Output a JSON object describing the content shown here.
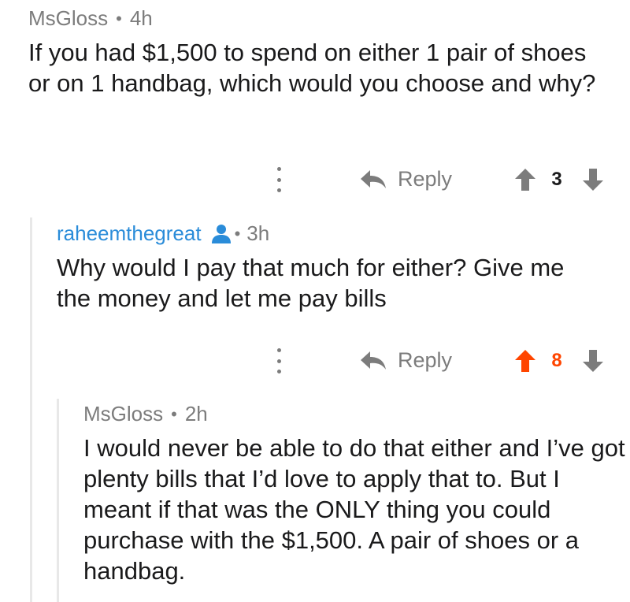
{
  "colors": {
    "meta_gray": "#7c7c7c",
    "username_blue": "#2a8cd9",
    "upvote_orange": "#ff4500",
    "icon_gray": "#7c7c7c",
    "thread_line": "#e8e8e8"
  },
  "comments": [
    {
      "author": "MsGloss",
      "separator": "•",
      "time": "4h",
      "body": "If you had $1,500 to spend on either 1 pair of shoes or on 1 handbag, which would you choose and why?",
      "reply_label": "Reply",
      "score": "3",
      "upvoted": false
    },
    {
      "author": "raheemthegreat",
      "author_icon": "user-icon",
      "separator": "•",
      "time": "3h",
      "body": "Why would I pay that much for either? Give me the money and let me pay bills",
      "reply_label": "Reply",
      "score": "8",
      "upvoted": true
    },
    {
      "author": "MsGloss",
      "separator": "•",
      "time": "2h",
      "body": "I would never be able to do that either and I’ve got plenty bills that I’d love to apply that to. But I meant if that was the ONLY thing you could purchase with the $1,500. A pair of shoes or a handbag."
    }
  ]
}
